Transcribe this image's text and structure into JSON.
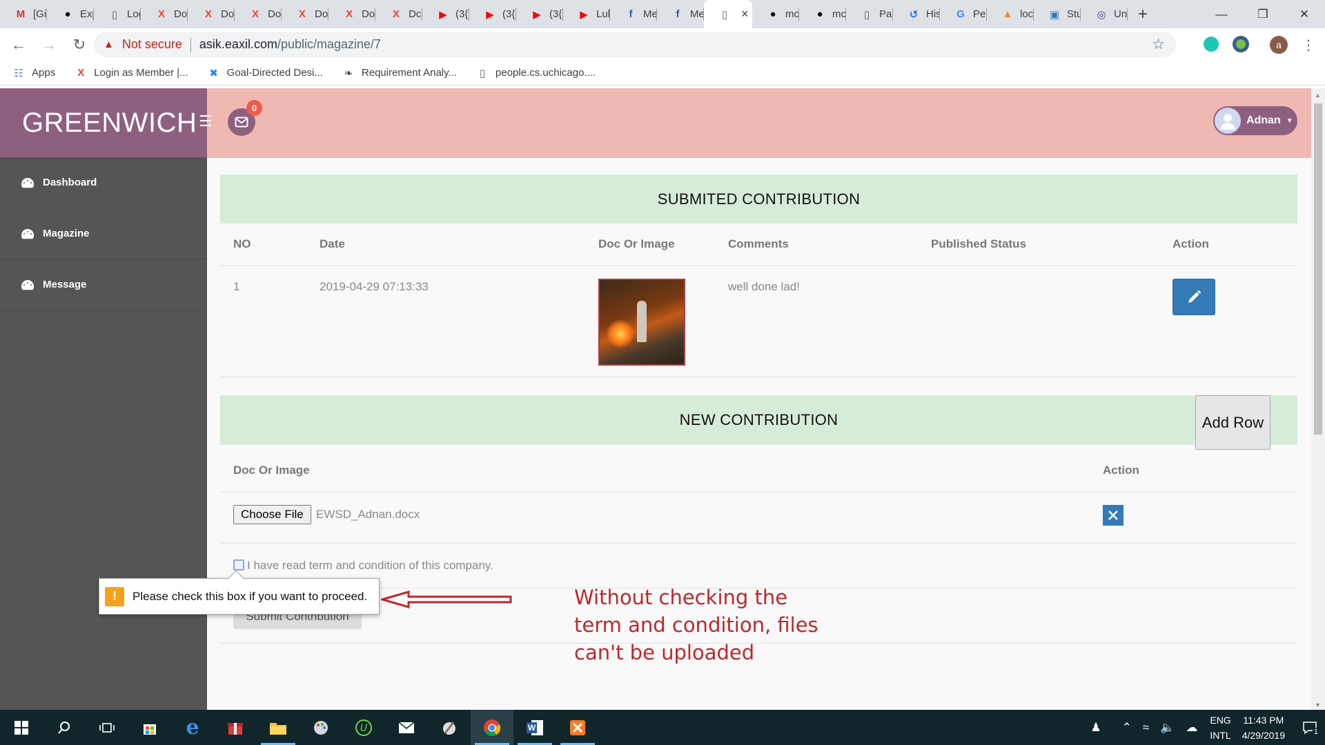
{
  "browser": {
    "tabs": [
      {
        "icon": "gmail-icon",
        "label": "[Gi",
        "color": "#d93025"
      },
      {
        "icon": "github-icon",
        "label": "Exp",
        "color": "#111"
      },
      {
        "icon": "page-icon",
        "label": "Log",
        "color": "#5f6368"
      },
      {
        "icon": "x-brand-icon",
        "label": "Do",
        "color": "#e8453c"
      },
      {
        "icon": "x-brand-icon",
        "label": "Do",
        "color": "#e8453c"
      },
      {
        "icon": "x-brand-icon",
        "label": "Do",
        "color": "#e8453c"
      },
      {
        "icon": "x-brand-icon",
        "label": "Do",
        "color": "#e8453c"
      },
      {
        "icon": "x-brand-icon",
        "label": "Do",
        "color": "#e8453c"
      },
      {
        "icon": "x-brand-icon",
        "label": "Dc",
        "color": "#e8453c"
      },
      {
        "icon": "youtube-icon",
        "label": "(3{",
        "color": "#ff0000"
      },
      {
        "icon": "youtube-icon",
        "label": "(3{",
        "color": "#ff0000"
      },
      {
        "icon": "youtube-icon",
        "label": "(3{",
        "color": "#ff0000"
      },
      {
        "icon": "youtube-icon",
        "label": "Lul",
        "color": "#ff0000"
      },
      {
        "icon": "facebook-icon",
        "label": "Me",
        "color": "#3b5998"
      },
      {
        "icon": "facebook-icon",
        "label": "Me",
        "color": "#3b5998"
      },
      {
        "icon": "page-icon",
        "label": "",
        "color": "#5f6368",
        "active": true
      },
      {
        "icon": "github-icon",
        "label": "mc",
        "color": "#111"
      },
      {
        "icon": "github-icon",
        "label": "mc",
        "color": "#111"
      },
      {
        "icon": "page-icon",
        "label": "Pa",
        "color": "#5f6368"
      },
      {
        "icon": "history-icon",
        "label": "His",
        "color": "#1a73e8"
      },
      {
        "icon": "google-icon",
        "label": "Pe",
        "color": "#4285f4"
      },
      {
        "icon": "pma-icon",
        "label": "loc",
        "color": "#f29111"
      },
      {
        "icon": "site-icon",
        "label": "Stu",
        "color": "#2a7ab0"
      },
      {
        "icon": "tor-icon",
        "label": "Un",
        "color": "#3b4a7a"
      }
    ],
    "security_label": "Not secure",
    "url_host": "asik.eaxil.com",
    "url_path": "/public/magazine/7",
    "bookmarks": [
      {
        "icon": "apps-grid-icon",
        "label": "Apps"
      },
      {
        "icon": "x-brand-icon",
        "label": "Login as Member |..."
      },
      {
        "icon": "confluence-icon",
        "label": "Goal-Directed Desi..."
      },
      {
        "icon": "bird-icon",
        "label": "Requirement Analy..."
      },
      {
        "icon": "page-icon",
        "label": "people.cs.uchicago...."
      }
    ],
    "profile_initial": "a"
  },
  "app": {
    "brand": "GREENWICH",
    "notification_count": "0",
    "user_name": "Adnan",
    "menu": [
      "Dashboard",
      "Magazine",
      "Message"
    ],
    "colors": {
      "brand_bg": "#8f5f80",
      "sidebar_bg": "#555555",
      "topbar_bg": "#f0b8b3",
      "panel_head_bg": "#d6ecd9",
      "primary": "#337ab7"
    }
  },
  "submitted": {
    "title": "SUBMITED CONTRIBUTION",
    "columns": [
      "NO",
      "Date",
      "Doc Or Image",
      "Comments",
      "Published Status",
      "Action"
    ],
    "rows": [
      {
        "no": "1",
        "date": "2019-04-29 07:13:33",
        "comment": "well done lad!",
        "status": ""
      }
    ]
  },
  "new_contribution": {
    "title": "NEW CONTRIBUTION",
    "add_row_label": "Add Row",
    "columns": [
      "Doc Or Image",
      "Action"
    ],
    "choose_file_label": "Choose File",
    "file_name": "EWSD_Adnan.docx",
    "terms_label": "I have read term and condition of this company.",
    "submit_label": "Submit Contribution"
  },
  "validation_tooltip": "Please check this box if you want to proceed.",
  "annotation": "Without checking the term and condition, files can't be uploaded",
  "taskbar": {
    "lang_top": "ENG",
    "lang_bottom": "INTL",
    "time": "11:43 PM",
    "date": "4/29/2019",
    "notification_count": "1"
  }
}
